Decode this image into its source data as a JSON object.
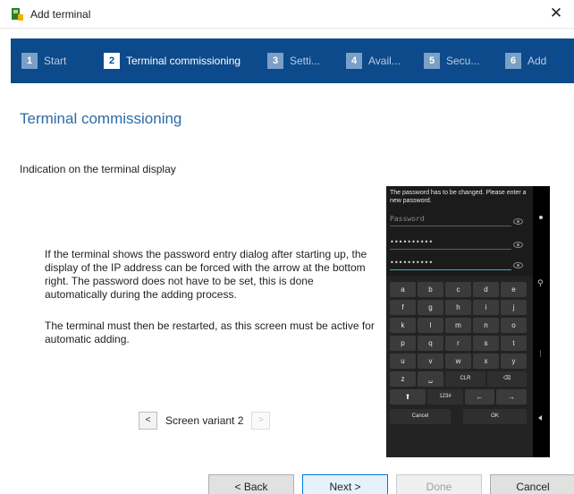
{
  "window": {
    "title": "Add terminal",
    "close_glyph": "✕"
  },
  "steps": [
    {
      "num": "1",
      "label": "Start",
      "active": false
    },
    {
      "num": "2",
      "label": "Terminal commissioning",
      "active": true
    },
    {
      "num": "3",
      "label": "Setti...",
      "active": false
    },
    {
      "num": "4",
      "label": "Avail...",
      "active": false
    },
    {
      "num": "5",
      "label": "Secu...",
      "active": false
    },
    {
      "num": "6",
      "label": "Add",
      "active": false
    }
  ],
  "content": {
    "title": "Terminal commissioning",
    "subheading": "Indication on the terminal display",
    "paragraph1": "If the terminal shows the password entry dialog after starting up, the display of the IP address can be forced with the arrow at the bottom right. The password does not have to be set, this is done automatically during the adding process.",
    "paragraph2": "The terminal must then be restarted, as this screen must be active for automatic adding.",
    "variant": {
      "prev": "<",
      "label": "Screen variant 2",
      "next": ">"
    }
  },
  "terminal": {
    "message": "The password has to be changed. Please enter a new password.",
    "fields": [
      "Password",
      "••••••••••",
      "••••••••••"
    ],
    "keys_row1": [
      "a",
      "b",
      "c",
      "d",
      "e"
    ],
    "keys_row2": [
      "f",
      "g",
      "h",
      "i",
      "j"
    ],
    "keys_row3": [
      "k",
      "l",
      "m",
      "n",
      "o"
    ],
    "keys_row4": [
      "p",
      "q",
      "r",
      "s",
      "t"
    ],
    "keys_row5": [
      "u",
      "v",
      "w",
      "x",
      "y"
    ],
    "keys_row6": [
      "z",
      "␣",
      "CLR",
      "⌫"
    ],
    "keys_row7": [
      "⬆",
      "123#",
      "←",
      "→"
    ],
    "cancel": "Cancel",
    "ok": "OK"
  },
  "footer": {
    "back": "< Back",
    "next": "Next >",
    "done": "Done",
    "cancel": "Cancel"
  },
  "colors": {
    "header_bg": "#0d4a8b",
    "title_blue": "#2d6aa8",
    "accent": "#0078d7"
  }
}
